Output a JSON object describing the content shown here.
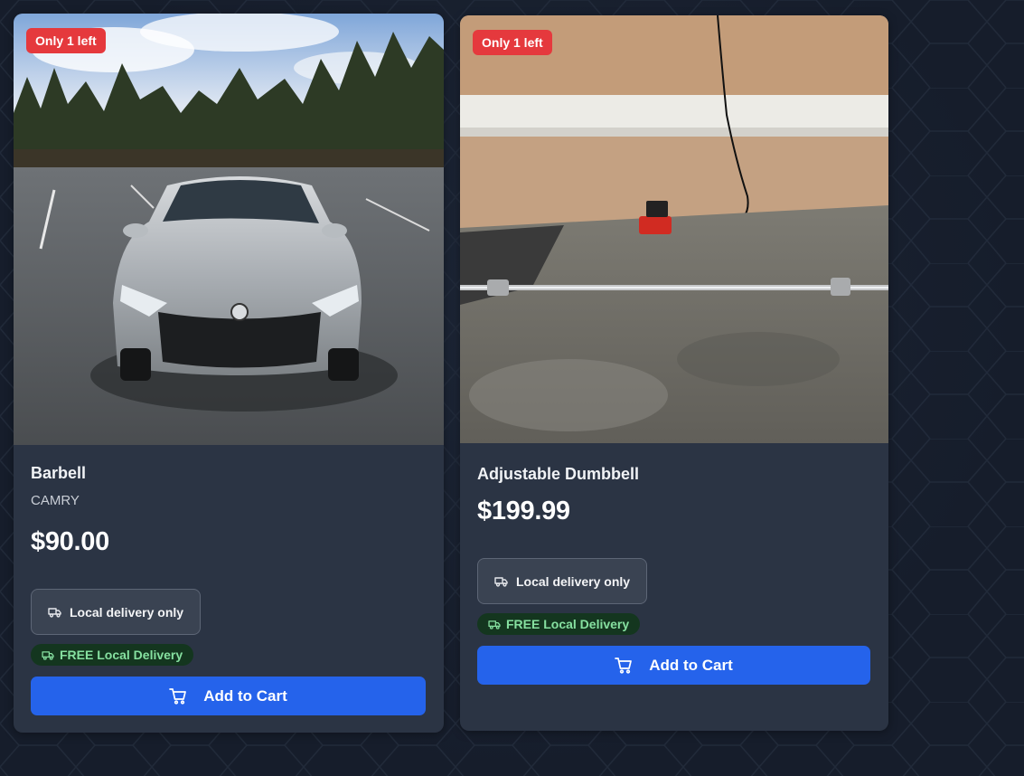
{
  "products": [
    {
      "stock_badge": "Only 1 left",
      "title": "Barbell",
      "subtitle": "CAMRY",
      "price": "$90.00",
      "delivery_label": "Local delivery only",
      "free_delivery_label": "FREE Local Delivery",
      "cart_label": "Add to Cart",
      "image_alt": "silver sedan in parking lot"
    },
    {
      "stock_badge": "Only 1 left",
      "title": "Adjustable Dumbbell",
      "price": "$199.99",
      "delivery_label": "Local delivery only",
      "free_delivery_label": "FREE Local Delivery",
      "cart_label": "Add to Cart",
      "image_alt": "barbell bar on concrete floor"
    }
  ],
  "icons": {
    "truck": "truck-icon",
    "cart": "shopping-cart-icon"
  },
  "colors": {
    "page_bg": "#161d2b",
    "card_bg": "#2b3444",
    "badge_red": "#e5393d",
    "button_blue": "#2563eb",
    "free_bg": "#14361f",
    "free_text": "#86e0a0"
  }
}
